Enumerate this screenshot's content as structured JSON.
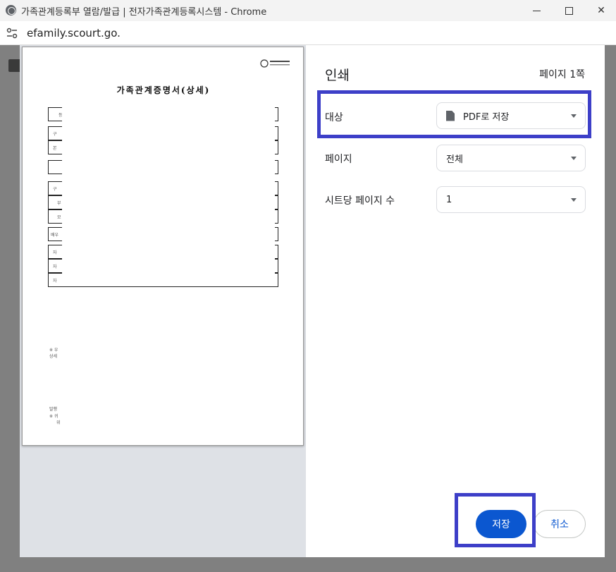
{
  "window": {
    "title": "가족관계등록부 열람/발급 | 전자가족관계등록시스템 - Chrome",
    "minimize_label": "minimize",
    "maximize_label": "maximize",
    "close_label": "✕"
  },
  "address": {
    "url": "efamily.scourt.go.kı"
  },
  "preview": {
    "doc_title": "가족관계증명서(상세)",
    "row_fragments": [
      "등",
      "구",
      "본",
      "구",
      "부",
      "모",
      "배우",
      "자",
      "자",
      "자"
    ],
    "footnote_lines": [
      "※ 우",
      "상세"
    ],
    "footer_lines": [
      "발행",
      "※ 귀",
      "위"
    ]
  },
  "print_panel": {
    "title": "인쇄",
    "page_count": "페이지 1쪽",
    "destination": {
      "label": "대상",
      "value": "PDF로 저장"
    },
    "pages": {
      "label": "페이지",
      "value": "전체"
    },
    "pages_per_sheet": {
      "label": "시트당 페이지 수",
      "value": "1"
    },
    "save_button": "저장",
    "cancel_button": "취소"
  },
  "colors": {
    "accent": "#0b57d0",
    "highlight": "#3d3fc8"
  }
}
